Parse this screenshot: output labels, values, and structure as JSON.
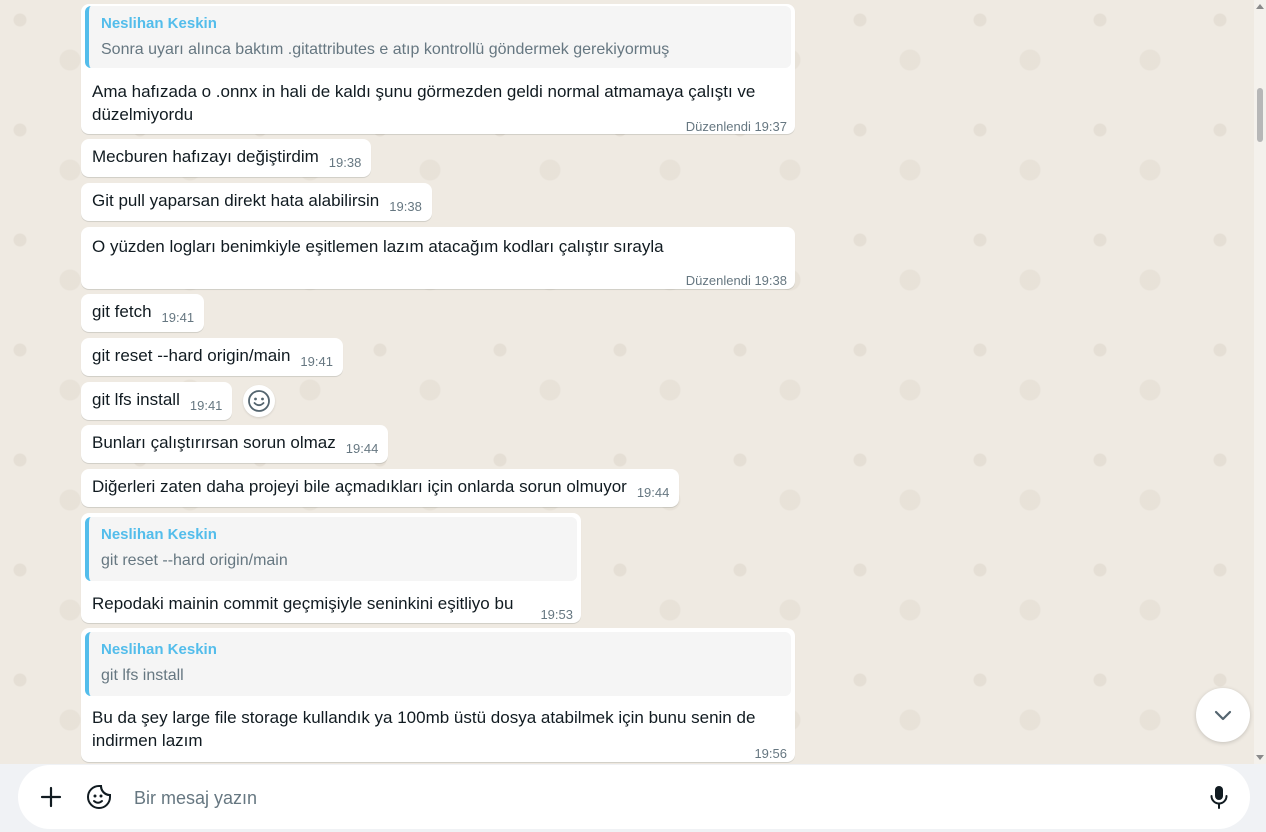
{
  "messages": [
    {
      "quote_name": "Neslihan Keskin",
      "quote_text": "Sonra uyarı alınca baktım .gitattributes e atıp kontrollü göndermek gerekiyormuş",
      "text": "Ama hafızada o .onnx in hali de kaldı şunu görmezden geldi normal atmamaya çalıştı ve düzelmiyordu",
      "edited": "Düzenlendi",
      "time": "19:37"
    },
    {
      "text": "Mecburen hafızayı değiştirdim",
      "time": "19:38"
    },
    {
      "text": "Git pull yaparsan direkt hata alabilirsin",
      "time": "19:38"
    },
    {
      "text": "O yüzden logları benimkiyle eşitlemen lazım atacağım kodları çalıştır sırayla",
      "edited": "Düzenlendi",
      "time": "19:38"
    },
    {
      "text": "git fetch",
      "time": "19:41"
    },
    {
      "text": "git reset --hard origin/main",
      "time": "19:41"
    },
    {
      "text": "git lfs install",
      "time": "19:41"
    },
    {
      "text": "Bunları çalıştırırsan sorun olmaz",
      "time": "19:44"
    },
    {
      "text": "Diğerleri zaten daha projeyi bile açmadıkları için onlarda sorun olmuyor",
      "time": "19:44"
    },
    {
      "quote_name": "Neslihan Keskin",
      "quote_text": "git reset --hard origin/main",
      "text": "Repodaki mainin commit geçmişiyle seninkini eşitliyo bu",
      "time": "19:53"
    },
    {
      "quote_name": "Neslihan Keskin",
      "quote_text": "git lfs install",
      "text": "Bu da şey large file storage kullandık ya 100mb üstü dosya atabilmek için bunu senin de indirmen lazım",
      "time": "19:56"
    }
  ],
  "composer": {
    "placeholder": "Bir mesaj yazın"
  },
  "icons": {
    "reaction": "smiley-icon",
    "scroll": "chevron-down-icon",
    "attach": "plus-icon",
    "sticker": "sticker-icon",
    "voice": "microphone-icon"
  },
  "colors": {
    "accent": "#53bdeb",
    "bubble": "#ffffff",
    "background": "#efeae2"
  }
}
